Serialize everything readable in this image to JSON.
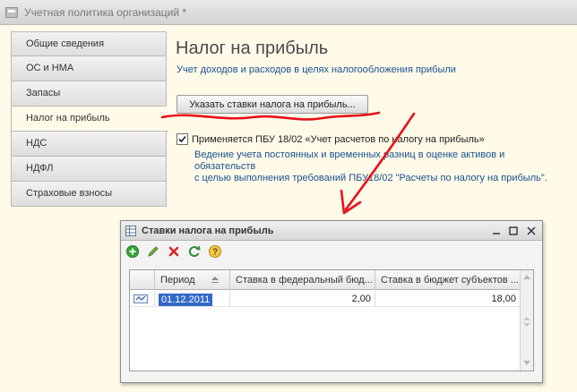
{
  "window": {
    "title": "Учетная политика организаций *"
  },
  "tabs": [
    {
      "label": "Общие сведения",
      "active": false
    },
    {
      "label": "ОС и НМА",
      "active": false
    },
    {
      "label": "Запасы",
      "active": false
    },
    {
      "label": "Налог на прибыль",
      "active": true
    },
    {
      "label": "НДС",
      "active": false
    },
    {
      "label": "НДФЛ",
      "active": false
    },
    {
      "label": "Страховые взносы",
      "active": false
    }
  ],
  "content": {
    "heading": "Налог на прибыль",
    "subtitle": "Учет доходов и расходов в целях налогообложения прибыли",
    "rates_button": "Указать ставки налога на прибыль...",
    "pbu_checkbox": {
      "label": "Применяется ПБУ 18/02 «Учет расчетов по налогу на прибыль»",
      "checked": true
    },
    "description_line1": "Ведение учета постоянных и временных разниц в оценке активов и обязательств",
    "description_line2": "с целью выполнения требований ПБУ18/02 \"Расчеты по налогу на прибыль\"."
  },
  "dialog": {
    "title": "Ставки налога на прибыль",
    "toolbar": [
      "add-icon",
      "edit-icon",
      "delete-icon",
      "refresh-icon",
      "help-icon"
    ],
    "columns": [
      "Период",
      "Ставка в федеральный бюд...",
      "Ставка в бюджет субъектов ..."
    ],
    "rows": [
      {
        "period": "01.12.2011",
        "federal": "2,00",
        "regional": "18,00"
      }
    ]
  },
  "colors": {
    "accent_text": "#1a4f8f",
    "annotation": "#e8101a",
    "selection": "#3169c6"
  }
}
